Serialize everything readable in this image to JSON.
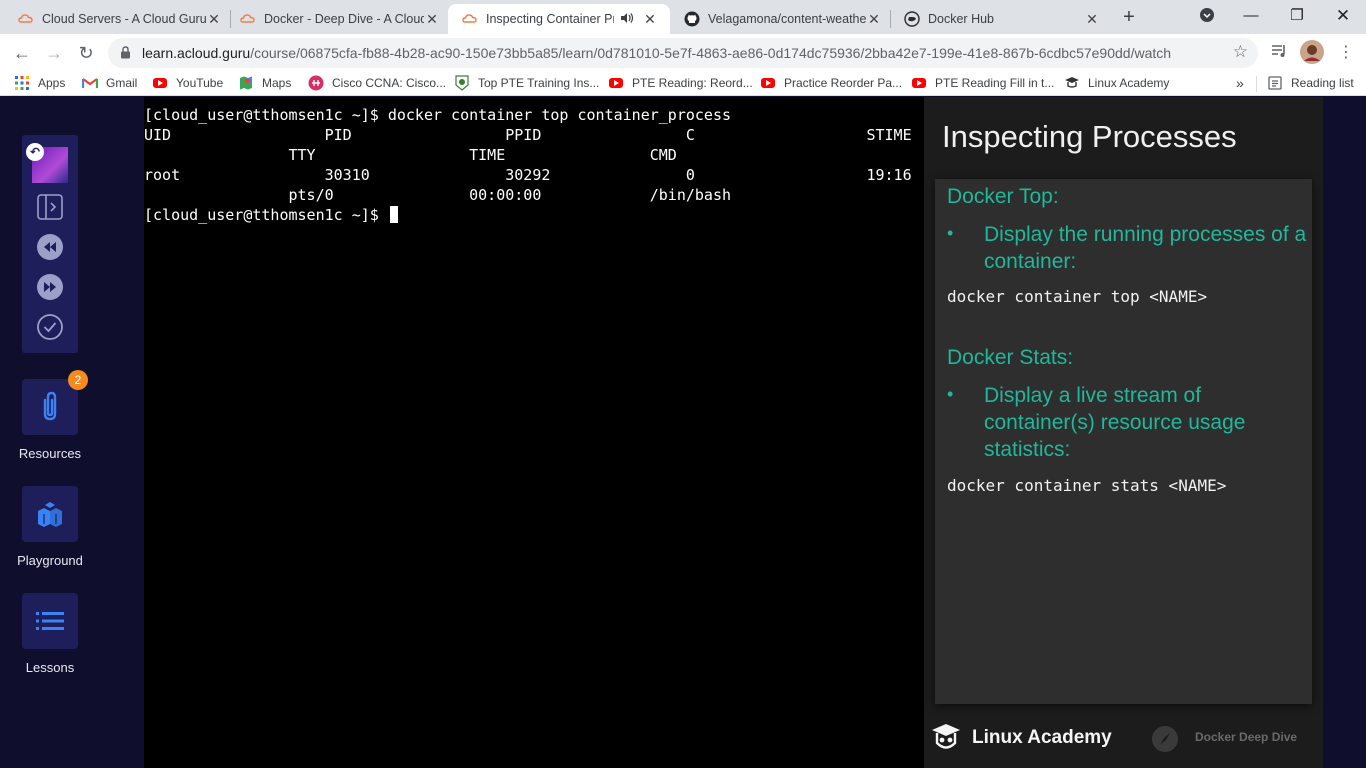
{
  "browser": {
    "tabs": [
      {
        "title": "Cloud Servers - A Cloud Guru",
        "favicon": "acg-icon"
      },
      {
        "title": "Docker - Deep Dive - A Cloud Guru",
        "favicon": "acg-icon"
      },
      {
        "title": "Inspecting Container Processes",
        "favicon": "acg-icon",
        "active": true,
        "audio": true
      },
      {
        "title": "Velagamona/content-weather",
        "favicon": "github-icon"
      },
      {
        "title": "Docker Hub",
        "favicon": "docker-icon"
      }
    ],
    "url_host": "learn.acloud.guru",
    "url_path": "/course/06875cfa-fb88-4b28-ac90-150e73bb5a85/learn/0d781010-5e7f-4863-ae86-0d174dc75936/2bba42e7-199e-41e8-867b-6cdbc57e90dd/watch",
    "bookmarks": [
      {
        "label": "Apps",
        "icon": "apps-grid-icon"
      },
      {
        "label": "Gmail",
        "icon": "gmail-icon"
      },
      {
        "label": "YouTube",
        "icon": "youtube-icon"
      },
      {
        "label": "Maps",
        "icon": "maps-icon"
      },
      {
        "label": "Cisco CCNA: Cisco...",
        "icon": "cisco-icon"
      },
      {
        "label": "Top PTE Training Ins...",
        "icon": "pte-icon"
      },
      {
        "label": "PTE Reading: Reord...",
        "icon": "youtube-icon"
      },
      {
        "label": "Practice Reorder Pa...",
        "icon": "youtube-icon"
      },
      {
        "label": "PTE Reading Fill in t...",
        "icon": "youtube-icon"
      },
      {
        "label": "Linux Academy",
        "icon": "linux-academy-icon"
      }
    ],
    "more_bookmarks": "»",
    "reading_list": "Reading list"
  },
  "sidebar": {
    "resources_label": "Resources",
    "resources_badge": "2",
    "playground_label": "Playground",
    "lessons_label": "Lessons"
  },
  "terminal": {
    "lines": [
      "[cloud_user@tthomsen1c ~]$ docker container top container_process",
      "UID                 PID                 PPID                C                   STIME",
      "                TTY                 TIME                CMD",
      "root                30310               30292               0                   19:16",
      "                pts/0               00:00:00            /bin/bash",
      "[cloud_user@tthomsen1c ~]$ "
    ]
  },
  "slide": {
    "title": "Inspecting Processes",
    "section1_heading": "Docker Top:",
    "section1_bullet": "Display the running processes of a container:",
    "section1_cmd": "docker container top <NAME>",
    "section2_heading": "Docker Stats:",
    "section2_bullet": "Display a live stream of container(s) resource usage statistics:",
    "section2_cmd": "docker container stats <NAME>",
    "brand": "Linux Academy",
    "course": "Docker Deep Dive",
    "accent_color": "#1fb89a"
  }
}
